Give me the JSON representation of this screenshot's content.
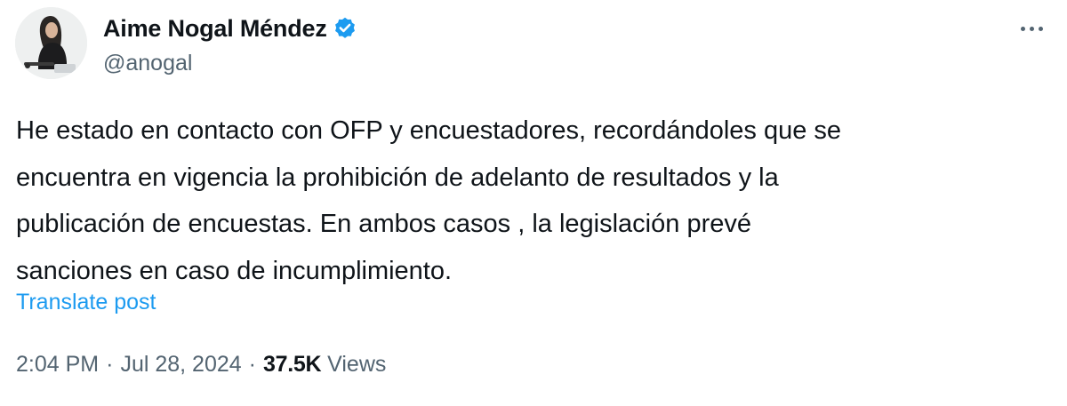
{
  "author": {
    "display_name": "Aime Nogal Méndez",
    "handle": "@anogal",
    "verified": true,
    "verified_color": "#1d9bf0",
    "avatar_icon": "profile-photo"
  },
  "post": {
    "text_lines": [
      "He estado en contacto con OFP y encuestadores, recordándoles que se",
      "encuentra en vigencia la prohibición de adelanto de resultados y la",
      "publicación de encuestas. En ambos casos , la legislación prevé",
      "sanciones en caso de incumplimiento."
    ],
    "translate_label": "Translate post",
    "time": "2:04 PM",
    "separator": "·",
    "date": "Jul 28, 2024",
    "views_count": "37.5K",
    "views_label": "Views"
  },
  "menu": {
    "more_icon": "more-horizontal-icon"
  },
  "colors": {
    "text_primary": "#0f1419",
    "text_secondary": "#536471",
    "link": "#1d9bf0"
  }
}
